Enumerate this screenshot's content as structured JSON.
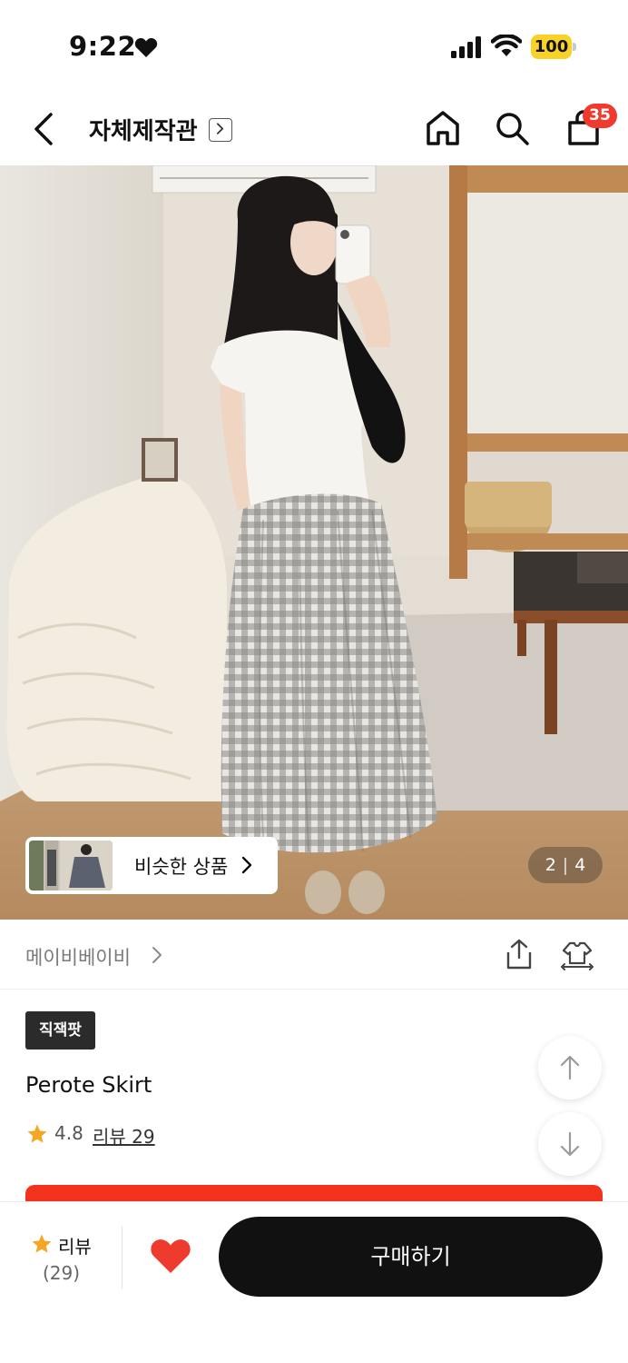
{
  "status_bar": {
    "time": "9:22",
    "battery": "100",
    "battery_color": "#f8d227"
  },
  "nav": {
    "title": "자체제작관",
    "cart_count": "35",
    "badge_color": "#ee3b2e",
    "icons": [
      "back-icon",
      "home-icon",
      "search-icon",
      "shopping-bag-icon"
    ]
  },
  "hero": {
    "similar_label": "비슷한 상품",
    "page_current": "2",
    "page_separator": "|",
    "page_total": "4"
  },
  "brand": {
    "name": "메이비베이비",
    "icons": [
      "share-icon",
      "fitting-icon"
    ]
  },
  "product": {
    "tag": "직잭팟",
    "name": "Perote Skirt",
    "rating": "4.8",
    "review_link": "리뷰 29",
    "star_color": "#f5a623",
    "promo_color": "#f2321c"
  },
  "bottom_bar": {
    "review_label": "리뷰",
    "review_count": "(29)",
    "buy_label": "구매하기",
    "heart_color": "#ee3b2e"
  }
}
